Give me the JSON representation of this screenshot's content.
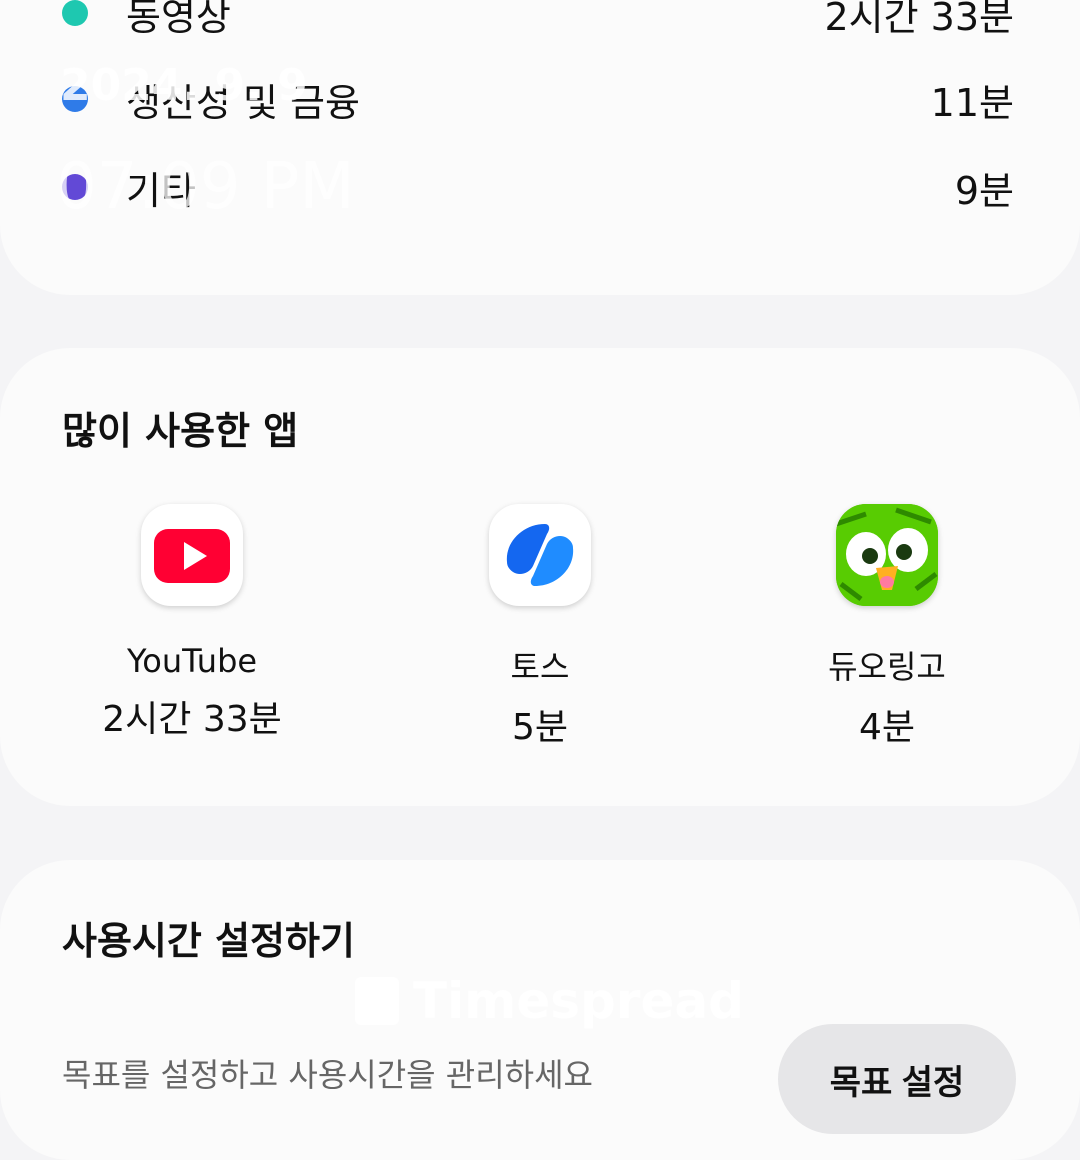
{
  "categories": [
    {
      "name": "동영상",
      "time": "2시간 33분",
      "color": "#1ec8b0"
    },
    {
      "name": "생산성 및 금융",
      "time": "11분",
      "color": "#2f7be8"
    },
    {
      "name": "기타",
      "time": "9분",
      "color": "#6249d6"
    }
  ],
  "top_apps": {
    "title": "많이 사용한 앱",
    "apps": [
      {
        "name": "YouTube",
        "time": "2시간 33분",
        "icon": "youtube-icon"
      },
      {
        "name": "토스",
        "time": "5분",
        "icon": "toss-icon"
      },
      {
        "name": "듀오링고",
        "time": "4분",
        "icon": "duolingo-icon"
      }
    ]
  },
  "usage_goal": {
    "title": "사용시간 설정하기",
    "description": "목표를 설정하고 사용시간을 관리하세요",
    "button": "목표 설정"
  },
  "overlay": {
    "date": "2024. 9. 9",
    "time": "07:09 PM",
    "watermark": "Timespread"
  }
}
